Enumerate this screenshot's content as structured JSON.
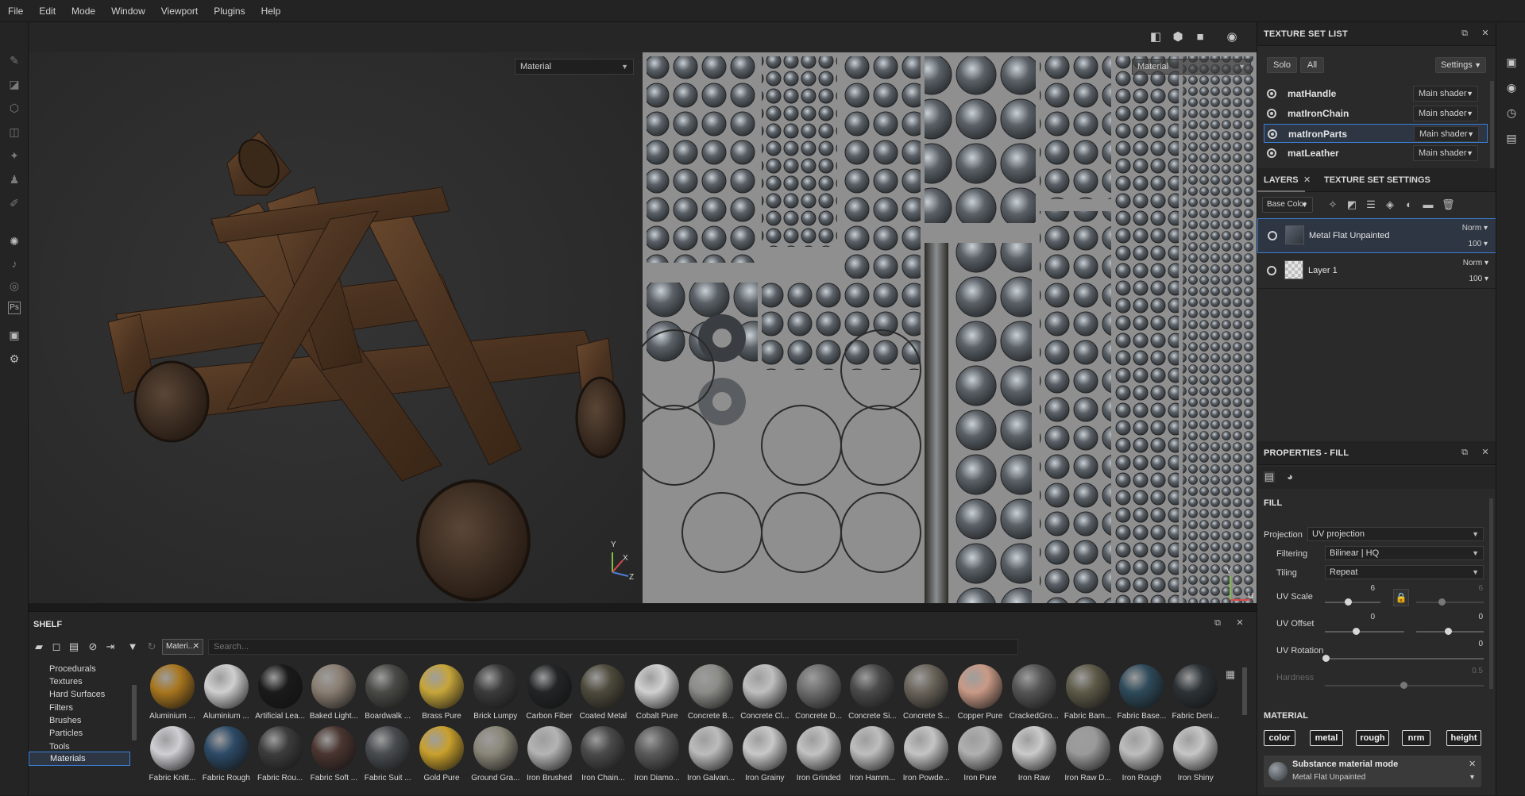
{
  "menu": [
    "File",
    "Edit",
    "Mode",
    "Window",
    "Viewport",
    "Plugins",
    "Help"
  ],
  "viewport": {
    "left_channel": "Material",
    "right_channel": "Material",
    "axis_y": "Y",
    "axis_z": "Z",
    "axis_x": "X",
    "axis_v": "V",
    "axis_u": "U"
  },
  "texture_set_list": {
    "title": "TEXTURE SET LIST",
    "solo": "Solo",
    "all": "All",
    "settings": "Settings",
    "sets": [
      {
        "name": "matHandle",
        "shader": "Main shader"
      },
      {
        "name": "matIronChain",
        "shader": "Main shader"
      },
      {
        "name": "matIronParts",
        "shader": "Main shader",
        "selected": true
      },
      {
        "name": "matLeather",
        "shader": "Main shader"
      }
    ]
  },
  "layers": {
    "tab_layers": "LAYERS",
    "tab_tss": "TEXTURE SET SETTINGS",
    "channel": "Base Color",
    "items": [
      {
        "name": "Metal Flat Unpainted",
        "blend": "Norm",
        "opacity": "100"
      },
      {
        "name": "Layer 1",
        "blend": "Norm",
        "opacity": "100"
      }
    ]
  },
  "properties": {
    "title": "PROPERTIES - FILL",
    "section_fill": "FILL",
    "projection_label": "Projection",
    "projection_value": "UV projection",
    "filtering_label": "Filtering",
    "filtering_value": "Bilinear | HQ",
    "tiling_label": "Tiling",
    "tiling_value": "Repeat",
    "uv_scale_label": "UV Scale",
    "uv_scale_value": "6",
    "uv_scale_value2": "6",
    "uv_offset_label": "UV Offset",
    "uv_offset_value": "0",
    "uv_offset_value2": "0",
    "uv_rotation_label": "UV Rotation",
    "uv_rotation_value": "0",
    "hardness_label": "Hardness",
    "hardness_value": "0.5",
    "section_material": "MATERIAL",
    "channels": [
      "color",
      "metal",
      "rough",
      "nrm",
      "height"
    ],
    "mode_title": "Substance material mode",
    "mode_value": "Metal Flat Unpainted"
  },
  "shelf": {
    "title": "SHELF",
    "filter_tag": "Materi...",
    "search_placeholder": "Search...",
    "categories": [
      "Procedurals",
      "Textures",
      "Hard Surfaces",
      "Filters",
      "Brushes",
      "Particles",
      "Tools",
      "Materials"
    ],
    "selected_category": "Materials",
    "materials_row1": [
      "Aluminium ...",
      "Aluminium ...",
      "Artificial Lea...",
      "Baked Light...",
      "Boardwalk ...",
      "Brass Pure",
      "Brick Lumpy",
      "Carbon Fiber",
      "Coated Metal",
      "Cobalt Pure",
      "Concrete B...",
      "Concrete Cl...",
      "Concrete D...",
      "Concrete Si...",
      "Concrete S...",
      "Copper Pure",
      "CrackedGro...",
      "Fabric Bam...",
      "Fabric Base...",
      "Fabric Deni..."
    ],
    "materials_row2": [
      "Fabric Knitt...",
      "Fabric Rough",
      "Fabric Rou...",
      "Fabric Soft ...",
      "Fabric Suit ...",
      "Gold Pure",
      "Ground Gra...",
      "Iron Brushed",
      "Iron Chain...",
      "Iron Diamo...",
      "Iron Galvan...",
      "Iron Grainy",
      "Iron Grinded",
      "Iron Hamm...",
      "Iron Powde...",
      "Iron Pure",
      "Iron Raw",
      "Iron Raw D...",
      "Iron Rough",
      "Iron Shiny"
    ],
    "colors_row1": [
      "#a8761e",
      "#cfcfcf",
      "#1a1a1a",
      "#8a7e72",
      "#4a4a46",
      "#c6a53a",
      "#3b3b3b",
      "#222426",
      "#4e4a3c",
      "#d0d0d0",
      "#8c8c88",
      "#bfbfbf",
      "#6e6e6e",
      "#4a4a4a",
      "#6a645a",
      "#c99a86",
      "#555555",
      "#5e5a48",
      "#2e4a5a",
      "#2c3236"
    ],
    "colors_row2": [
      "#cfcfd4",
      "#2d4a66",
      "#3c3c3c",
      "#4a3530",
      "#484c50",
      "#c9a02c",
      "#8a8678",
      "#b4b4b4",
      "#4a4a4a",
      "#5a5a5a",
      "#bcbcbc",
      "#c8c8c8",
      "#c2c2c2",
      "#bebebe",
      "#c4c4c4",
      "#b0b0b0",
      "#cacaca",
      "#9a9a9a",
      "#bdbdbd",
      "#c6c6c6"
    ]
  }
}
